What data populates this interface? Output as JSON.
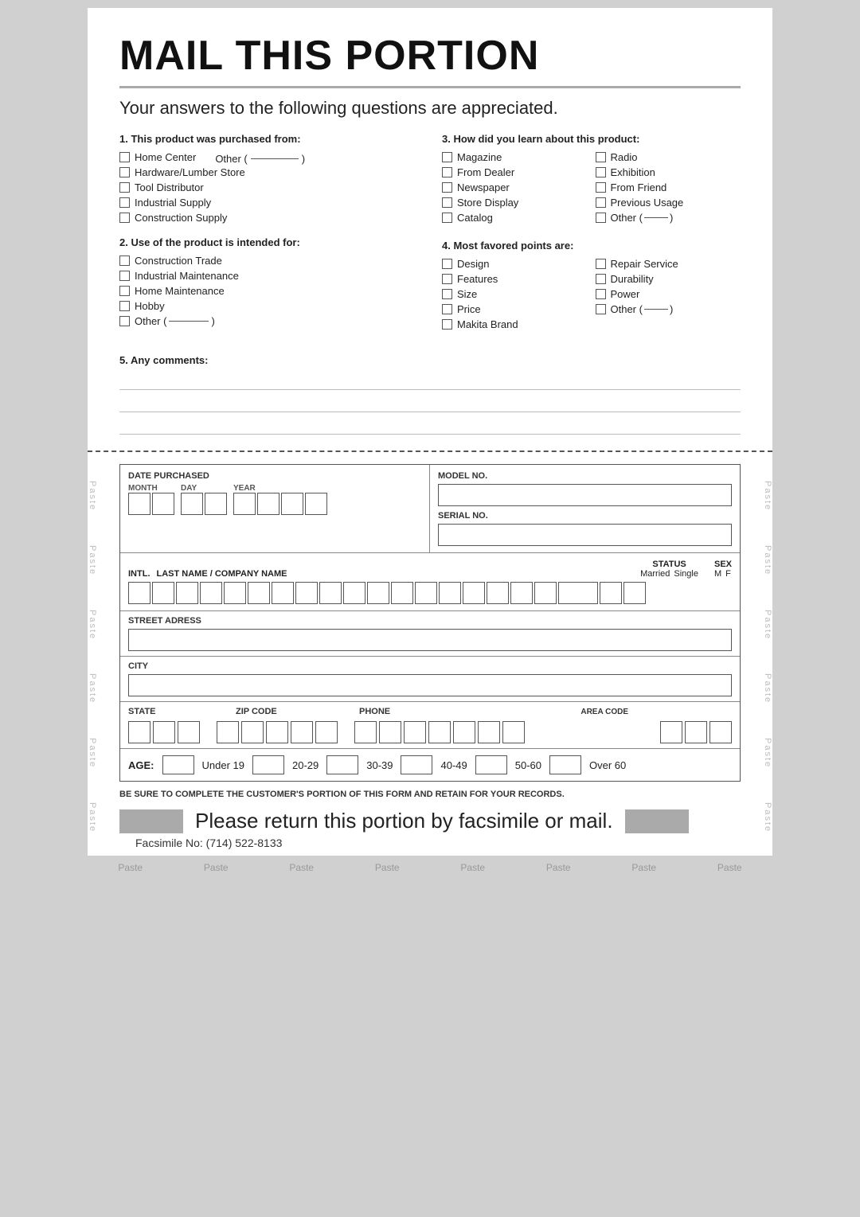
{
  "main_title": "MAIL THIS PORTION",
  "subtitle": "Your answers to the following questions are appreciated.",
  "divider": true,
  "questions": {
    "q1": {
      "title": "1. This product was purchased from:",
      "items_left": [
        {
          "id": "home-center",
          "label": "Home Center"
        },
        {
          "id": "hardware",
          "label": "Hardware/Lumber Store"
        },
        {
          "id": "tool-dist",
          "label": "Tool Distributor"
        },
        {
          "id": "industrial",
          "label": "Industrial Supply"
        },
        {
          "id": "construction",
          "label": "Construction Supply"
        }
      ],
      "other_label": "Other (",
      "other_close": ")"
    },
    "q2": {
      "title": "2. Use of the product is intended for:",
      "items": [
        {
          "id": "const-trade",
          "label": "Construction Trade"
        },
        {
          "id": "ind-maint",
          "label": "Industrial Maintenance"
        },
        {
          "id": "home-maint",
          "label": "Home Maintenance"
        },
        {
          "id": "hobby",
          "label": "Hobby"
        },
        {
          "id": "other2",
          "label": "Other (",
          "close": ")"
        }
      ]
    },
    "q3": {
      "title": "3. How did you learn about this product:",
      "col1": [
        {
          "id": "magazine",
          "label": "Magazine"
        },
        {
          "id": "from-dealer",
          "label": "From Dealer"
        },
        {
          "id": "newspaper",
          "label": "Newspaper"
        },
        {
          "id": "store-display",
          "label": "Store Display"
        },
        {
          "id": "catalog",
          "label": "Catalog"
        }
      ],
      "col2": [
        {
          "id": "radio",
          "label": "Radio"
        },
        {
          "id": "exhibition",
          "label": "Exhibition"
        },
        {
          "id": "from-friend",
          "label": "From Friend"
        },
        {
          "id": "prev-usage",
          "label": "Previous Usage"
        },
        {
          "id": "other3",
          "label": "Other (",
          "close": ")"
        }
      ]
    },
    "q4": {
      "title": "4. Most favored points are:",
      "col1": [
        {
          "id": "design",
          "label": "Design"
        },
        {
          "id": "features",
          "label": "Features"
        },
        {
          "id": "size",
          "label": "Size"
        },
        {
          "id": "price",
          "label": "Price"
        },
        {
          "id": "makita",
          "label": "Makita Brand"
        }
      ],
      "col2": [
        {
          "id": "repair",
          "label": "Repair Service"
        },
        {
          "id": "durability",
          "label": "Durability"
        },
        {
          "id": "power",
          "label": "Power"
        },
        {
          "id": "other4",
          "label": "Other (",
          "close": ")"
        }
      ]
    },
    "q5": {
      "title": "5. Any comments:",
      "lines": 3
    }
  },
  "lower_form": {
    "date_purchased_label": "DATE PURCHASED",
    "month_label": "MONTH",
    "day_label": "DAY",
    "year_label": "YEAR",
    "model_no_label": "MODEL NO.",
    "serial_no_label": "SERIAL NO.",
    "intl_label": "INTL.",
    "last_name_label": "LAST NAME / COMPANY NAME",
    "status_label": "STATUS",
    "married_label": "Married",
    "single_label": "Single",
    "sex_label": "SEX",
    "m_label": "M",
    "f_label": "F",
    "street_label": "STREET ADRESS",
    "city_label": "CITY",
    "state_label": "STATE",
    "zip_label": "ZIP CODE",
    "phone_label": "PHONE",
    "area_code_label": "AREA CODE",
    "age_label": "AGE:",
    "age_options": [
      {
        "label": "Under 19"
      },
      {
        "label": "20-29"
      },
      {
        "label": "30-39"
      },
      {
        "label": "40-49"
      },
      {
        "label": "50-60"
      },
      {
        "label": "Over 60"
      }
    ]
  },
  "retain_notice": "BE SURE TO COMPLETE THE CUSTOMER'S PORTION OF THIS FORM AND RETAIN FOR YOUR RECORDS.",
  "return_text": "Please return this portion by facsimile or mail.",
  "facsimile_label": "Facsimile No: (714) 522-8133",
  "paste_label": "Paste",
  "paste_labels_bottom": [
    "Paste",
    "Paste",
    "Paste",
    "Paste",
    "Paste",
    "Paste",
    "Paste",
    "Paste"
  ],
  "paste_labels_side": [
    "Paste",
    "Paste",
    "Paste",
    "Paste",
    "Paste",
    "Paste"
  ]
}
